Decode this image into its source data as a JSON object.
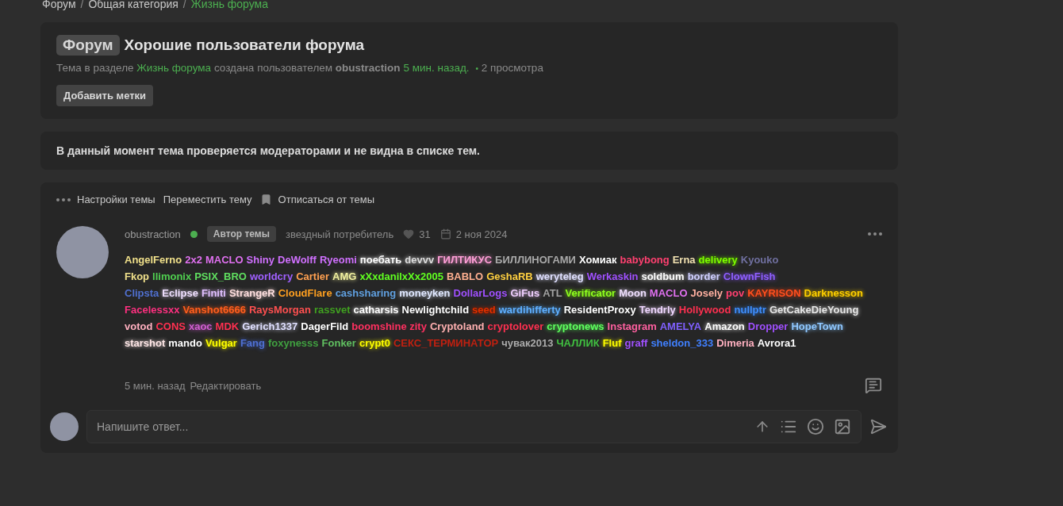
{
  "breadcrumbs": [
    {
      "label": "Форум",
      "current": false
    },
    {
      "label": "Общая категория",
      "current": false
    },
    {
      "label": "Жизнь форума",
      "current": true
    }
  ],
  "breadcrumb_separator": "/",
  "topic": {
    "prefix": "Форум",
    "title": "Хорошие пользователи форума",
    "meta_prefix": "Тема в разделе",
    "section": "Жизнь форума",
    "meta_middle": "создана пользователем",
    "author": "obustraction",
    "time": "5 мин. назад.",
    "views_bullet": "•",
    "views": "2 просмотра",
    "add_tags": "Добавить метки"
  },
  "notice": "В данный момент тема проверяется модераторами и не видна в списке тем.",
  "topic_actions": [
    {
      "label": "Настройки темы",
      "kind": "menu"
    },
    {
      "label": "Переместить тему",
      "kind": "plain"
    },
    {
      "label": "Отписаться от темы",
      "kind": "bookmark"
    }
  ],
  "post": {
    "author": "obustraction",
    "online": true,
    "badge": "Автор темы",
    "rank": "звездный потребитель",
    "likes": "31",
    "date": "2 ноя 2024",
    "name_lines": [
      [
        {
          "name": "AngelFerno",
          "color": "#f0e08a",
          "glow": false
        },
        {
          "name": "2x2",
          "color": "#e070f0",
          "glow": false
        },
        {
          "name": "MACLO",
          "color": "#e070f0",
          "glow": false
        },
        {
          "name": "Shiny",
          "color": "#d070ff",
          "glow": false
        },
        {
          "name": "DeWolff",
          "color": "#d070ff",
          "glow": false
        },
        {
          "name": "Ryeomi",
          "color": "#d070ff",
          "glow": false
        },
        {
          "name": "поебать",
          "color": "#ffffff",
          "glow": true
        },
        {
          "name": "devvv",
          "color": "#dddddd",
          "glow": true
        },
        {
          "name": "ГИЛТИКУС",
          "color": "#ffa0d8",
          "glow": true
        },
        {
          "name": "БИЛЛИНОГАМИ",
          "color": "#aaaaaa",
          "glow": false
        },
        {
          "name": "Хомиак",
          "color": "#ffffff",
          "glow": false
        },
        {
          "name": "babybong",
          "color": "#ff4070",
          "glow": false
        },
        {
          "name": "Erna",
          "color": "#f0e0b0",
          "glow": false
        },
        {
          "name": "delivery",
          "color": "#7fff00",
          "glow": true
        },
        {
          "name": "Kyouko",
          "color": "#7070a0",
          "glow": false
        }
      ],
      [
        {
          "name": "Fkop",
          "color": "#f0e08a",
          "glow": false
        },
        {
          "name": "llimonix",
          "color": "#50d050",
          "glow": false
        },
        {
          "name": "PSIX_BRO",
          "color": "#60e060",
          "glow": false
        },
        {
          "name": "worldcry",
          "color": "#a060ff",
          "glow": false
        },
        {
          "name": "Cartier",
          "color": "#ffa050",
          "glow": false
        },
        {
          "name": "AMG",
          "color": "#f0f0a0",
          "glow": true
        },
        {
          "name": "xXxdanilxXx2005",
          "color": "#60ff20",
          "glow": false
        },
        {
          "name": "BABLO",
          "color": "#ffb090",
          "glow": false
        },
        {
          "name": "GeshaRB",
          "color": "#ffd040",
          "glow": false
        },
        {
          "name": "weryteleg",
          "color": "#e0e0ff",
          "glow": true
        },
        {
          "name": "Werkaskin",
          "color": "#a050ff",
          "glow": false
        },
        {
          "name": "soldbum",
          "color": "#ffffff",
          "glow": true
        },
        {
          "name": "border",
          "color": "#d0d0ff",
          "glow": true
        },
        {
          "name": "ClownFish",
          "color": "#9060ff",
          "glow": true
        }
      ],
      [
        {
          "name": "Clipsta",
          "color": "#5070d0",
          "glow": false
        },
        {
          "name": "Eclipse",
          "color": "#f0e0ff",
          "glow": true
        },
        {
          "name": "Finiti",
          "color": "#e0c0ff",
          "glow": true
        },
        {
          "name": "StrangeR",
          "color": "#ffe0e0",
          "glow": true
        },
        {
          "name": "CloudFlare",
          "color": "#ffa020",
          "glow": false
        },
        {
          "name": "cashsharing",
          "color": "#60a0e0",
          "glow": false
        },
        {
          "name": "moneyken",
          "color": "#e0e8ff",
          "glow": true
        },
        {
          "name": "DollarLogs",
          "color": "#a050ff",
          "glow": false
        },
        {
          "name": "GiFus",
          "color": "#f0d0ff",
          "glow": true
        },
        {
          "name": "ATL",
          "color": "#a0a0a0",
          "glow": false
        },
        {
          "name": "Verificator",
          "color": "#90ff20",
          "glow": true
        },
        {
          "name": "Moon",
          "color": "#f0e0ff",
          "glow": true
        },
        {
          "name": "MACLO",
          "color": "#e070f0",
          "glow": false
        },
        {
          "name": "Josely",
          "color": "#ffb0a0",
          "glow": false
        },
        {
          "name": "pov",
          "color": "#ff4070",
          "glow": false
        },
        {
          "name": "KAYRISON",
          "color": "#ff5020",
          "glow": true
        },
        {
          "name": "Darknesson",
          "color": "#ffd000",
          "glow": true
        }
      ],
      [
        {
          "name": "Facelessxx",
          "color": "#ff3080",
          "glow": false
        },
        {
          "name": "Vanshot6666",
          "color": "#ff6020",
          "glow": true
        },
        {
          "name": "RaysMorgan",
          "color": "#ff5050",
          "glow": false
        },
        {
          "name": "rassvet",
          "color": "#40a020",
          "glow": false
        },
        {
          "name": "catharsis",
          "color": "#ffffff",
          "glow": true
        },
        {
          "name": "Newlightchild",
          "color": "#ffffff",
          "glow": false
        },
        {
          "name": "seed",
          "color": "#e03000",
          "glow": true
        },
        {
          "name": "wardihifferty",
          "color": "#60b0ff",
          "glow": true
        },
        {
          "name": "ResidentProxy",
          "color": "#ffffff",
          "glow": false
        },
        {
          "name": "Tendrly",
          "color": "#f0d8ff",
          "glow": true
        },
        {
          "name": "Hollywood",
          "color": "#ff3050",
          "glow": false
        },
        {
          "name": "nullptr",
          "color": "#4090ff",
          "glow": true
        },
        {
          "name": "GetCakeDieYoung",
          "color": "#e8e8e8",
          "glow": true
        }
      ],
      [
        {
          "name": "votod",
          "color": "#ffb0c0",
          "glow": false
        },
        {
          "name": "CONS",
          "color": "#ff3050",
          "glow": false
        },
        {
          "name": "xaoc",
          "color": "#d060d0",
          "glow": true
        },
        {
          "name": "MDK",
          "color": "#ff3050",
          "glow": false
        },
        {
          "name": "Gerich1337",
          "color": "#e0e0ff",
          "glow": true
        },
        {
          "name": "DagerFild",
          "color": "#ffffff",
          "glow": false
        },
        {
          "name": "boomshine zity",
          "color": "#ff3060",
          "glow": false
        },
        {
          "name": "Cryptoland",
          "color": "#ffb0b0",
          "glow": false
        },
        {
          "name": "cryptolover",
          "color": "#ff3050",
          "glow": false
        },
        {
          "name": "cryptonews",
          "color": "#60ff60",
          "glow": true
        },
        {
          "name": "Instagram",
          "color": "#ff60a0",
          "glow": false
        },
        {
          "name": "AMELYA",
          "color": "#8060ff",
          "glow": false
        },
        {
          "name": "Amazon",
          "color": "#ffffff",
          "glow": true
        },
        {
          "name": "Dropper",
          "color": "#a050ff",
          "glow": false
        },
        {
          "name": "HopeTown",
          "color": "#90c8ff",
          "glow": true
        }
      ],
      [
        {
          "name": "starshot",
          "color": "#ffe8e8",
          "glow": true
        },
        {
          "name": "mando",
          "color": "#ffffff",
          "glow": false
        },
        {
          "name": "Vulgar",
          "color": "#ffff00",
          "glow": true
        },
        {
          "name": "Fang",
          "color": "#5070d0",
          "glow": true
        },
        {
          "name": "foxynesss",
          "color": "#40a040",
          "glow": false
        },
        {
          "name": "Fonker",
          "color": "#60c060",
          "glow": false
        },
        {
          "name": "crypt0",
          "color": "#ffff00",
          "glow": true
        },
        {
          "name": "СЕКС_ТЕРМИНАТОР",
          "color": "#c02010",
          "glow": false
        },
        {
          "name": "чувак2013",
          "color": "#aaaaaa",
          "glow": false
        },
        {
          "name": "ЧАЛЛИК",
          "color": "#40c040",
          "glow": false
        },
        {
          "name": "Fluf",
          "color": "#ffff00",
          "glow": true
        },
        {
          "name": "graff",
          "color": "#a050ff",
          "glow": false
        },
        {
          "name": "sheldon_333",
          "color": "#4080ff",
          "glow": false
        },
        {
          "name": "Dimeria",
          "color": "#ffb0c0",
          "glow": false
        },
        {
          "name": "Avrora1",
          "color": "#ffffff",
          "glow": false
        }
      ]
    ],
    "footer_time": "5 мин. назад",
    "edit": "Редактировать"
  },
  "reply": {
    "placeholder": "Напишите ответ..."
  }
}
